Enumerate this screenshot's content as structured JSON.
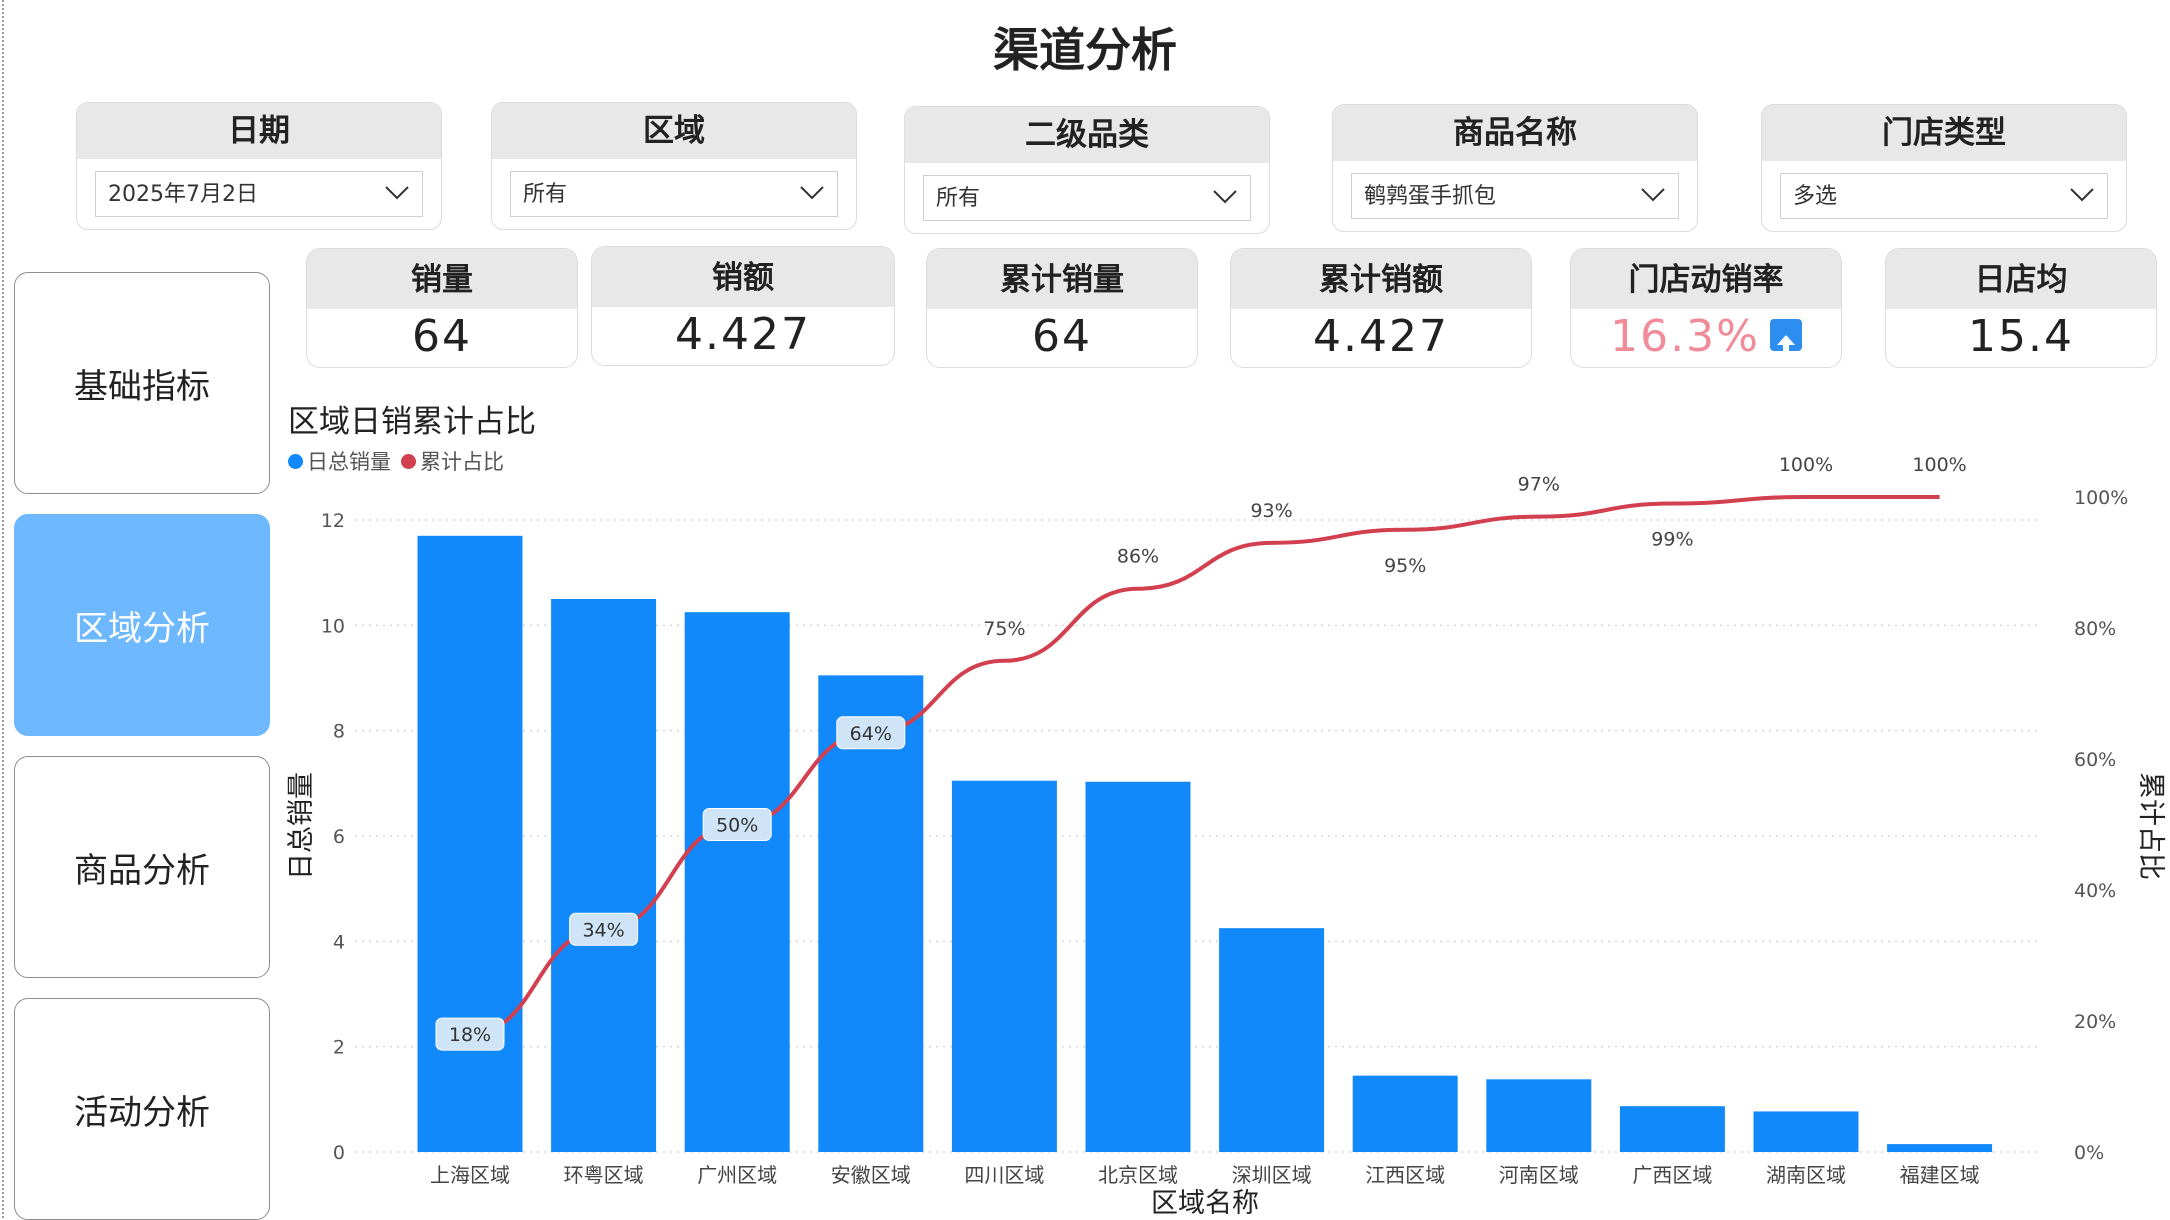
{
  "title": "渠道分析",
  "filters": [
    {
      "label": "日期",
      "value": "2025年7月2日"
    },
    {
      "label": "区域",
      "value": "所有"
    },
    {
      "label": "二级品类",
      "value": "所有"
    },
    {
      "label": "商品名称",
      "value": "鹌鹑蛋手抓包"
    },
    {
      "label": "门店类型",
      "value": "多选"
    }
  ],
  "nav": [
    {
      "label": "基础指标",
      "active": false
    },
    {
      "label": "区域分析",
      "active": true
    },
    {
      "label": "商品分析",
      "active": false
    },
    {
      "label": "活动分析",
      "active": false
    }
  ],
  "kpis": [
    {
      "label": "销量",
      "value": "64"
    },
    {
      "label": "销额",
      "value": "4.427"
    },
    {
      "label": "累计销量",
      "value": "64"
    },
    {
      "label": "累计销额",
      "value": "4.427"
    },
    {
      "label": "门店动销率",
      "value": "16.3%",
      "icon": "arrow-up-icon",
      "color": "#f08b9a"
    },
    {
      "label": "日店均",
      "value": "15.4"
    }
  ],
  "colors": {
    "bar": "#1189fb",
    "line": "#d23f4f",
    "nav_active": "#6db8ff"
  },
  "chart_data": {
    "type": "bar",
    "title": "区域日销累计占比",
    "xlabel": "区域名称",
    "ylabel": "日总销量",
    "y2label": "累计占比",
    "ylim": [
      0,
      12
    ],
    "y2lim": [
      0,
      100
    ],
    "yticks": [
      "0",
      "2",
      "4",
      "6",
      "8",
      "10",
      "12"
    ],
    "y2ticks": [
      "0%",
      "20%",
      "40%",
      "60%",
      "80%",
      "100%"
    ],
    "legend": [
      "日总销量",
      "累计占比"
    ],
    "legend_position": "top-left",
    "grid": true,
    "categories": [
      "上海区域",
      "环粤区域",
      "广州区域",
      "安徽区域",
      "四川区域",
      "北京区域",
      "深圳区域",
      "江西区域",
      "河南区域",
      "广西区域",
      "湖南区域",
      "福建区域"
    ],
    "series": [
      {
        "name": "日总销量",
        "type": "bar",
        "values": [
          11.7,
          10.5,
          10.25,
          9.05,
          7.05,
          7.03,
          4.25,
          1.45,
          1.38,
          0.87,
          0.77,
          0.15
        ]
      },
      {
        "name": "累计占比",
        "type": "line",
        "values": [
          18,
          34,
          50,
          64,
          75,
          86,
          93,
          95,
          97,
          99,
          100,
          100
        ],
        "labels": [
          "18%",
          "34%",
          "50%",
          "64%",
          "75%",
          "86%",
          "93%",
          "95%",
          "97%",
          "99%",
          "100%",
          "100%"
        ]
      }
    ]
  }
}
